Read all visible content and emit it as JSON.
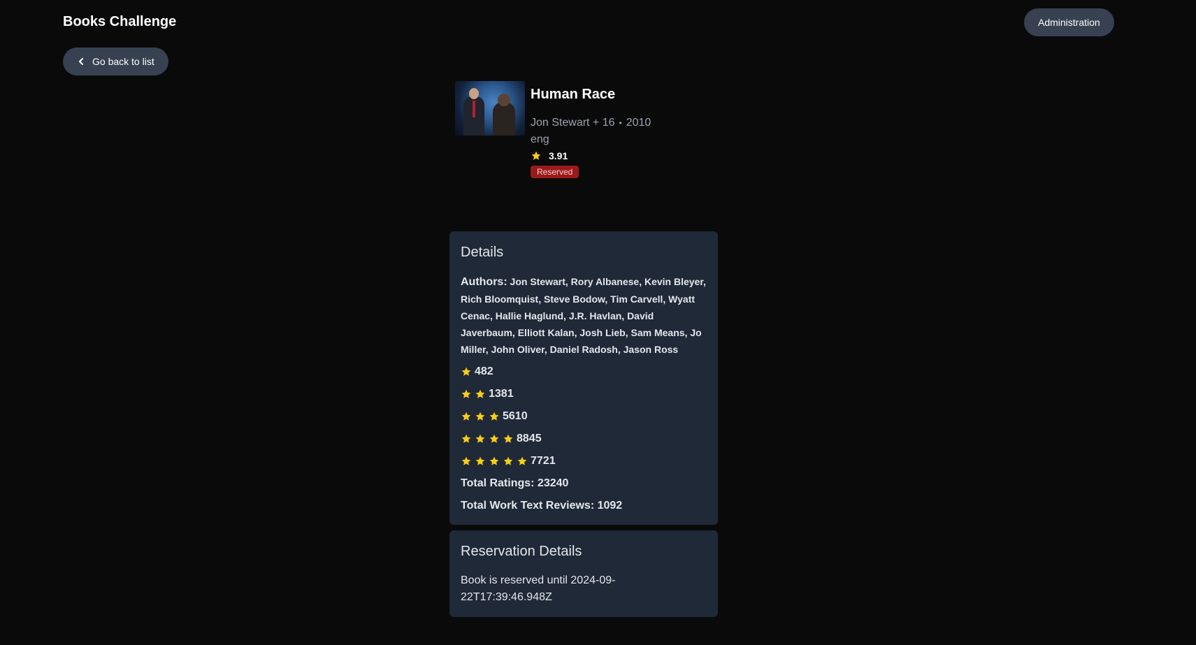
{
  "header": {
    "app_title": "Books Challenge",
    "admin_label": "Administration"
  },
  "nav": {
    "back_label": "Go back to list"
  },
  "book": {
    "title": "Human Race",
    "author_summary": "Jon Stewart + 16",
    "year": "2010",
    "language": "eng",
    "average_rating": "3.91",
    "status": "Reserved"
  },
  "details": {
    "title": "Details",
    "authors_label": "Authors:",
    "authors": "Jon Stewart, Rory Albanese, Kevin Bleyer, Rich Bloomquist, Steve Bodow, Tim Carvell, Wyatt Cenac, Hallie Haglund, J.R. Havlan, David Javerbaum, Elliott Kalan, Josh Lieb, Sam Means, Jo Miller, John Oliver, Daniel Radosh, Jason Ross",
    "distribution": [
      {
        "stars": 1,
        "count": "482"
      },
      {
        "stars": 2,
        "count": "1381"
      },
      {
        "stars": 3,
        "count": "5610"
      },
      {
        "stars": 4,
        "count": "8845"
      },
      {
        "stars": 5,
        "count": "7721"
      }
    ],
    "total_ratings": "Total Ratings: 23240",
    "total_reviews": "Total Work Text Reviews: 1092"
  },
  "reservation": {
    "title": "Reservation Details",
    "text": "Book is reserved until 2024-09-22T17:39:46.948Z"
  },
  "colors": {
    "star": "#facc15",
    "badge_bg": "#991b1b",
    "card_bg": "#1f2937"
  }
}
